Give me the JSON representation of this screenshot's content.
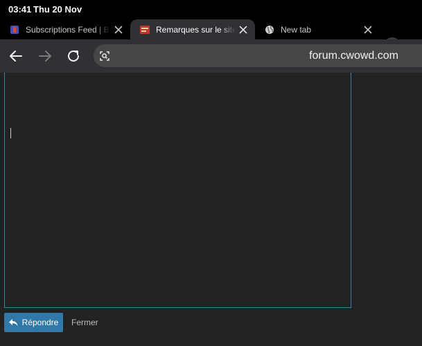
{
  "status_bar": {
    "time": "03:41",
    "date": "Thu 20 Nov"
  },
  "tabs": [
    {
      "title": "Subscriptions Feed | Boa",
      "favicon": "discourse-favicon",
      "active": false
    },
    {
      "title": "Remarques sur le site - f",
      "favicon": "cwowd-favicon",
      "active": true
    },
    {
      "title": "New tab",
      "favicon": "globe-icon",
      "active": false
    }
  ],
  "toolbar": {
    "url": "forum.cwowd.com"
  },
  "composer": {
    "reply_label": "Répondre",
    "close_label": "Fermer"
  },
  "colors": {
    "accent": "#2f78a8",
    "composer_border": "#3b82a8",
    "background": "#222222",
    "toolbar": "#303134"
  }
}
